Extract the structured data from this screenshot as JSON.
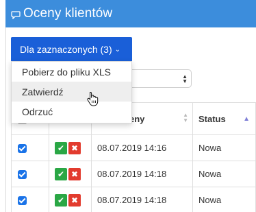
{
  "header": {
    "title": "Oceny klientów",
    "icon": "chat-icon"
  },
  "bulk_actions": {
    "button_label": "Dla zaznaczonych (3)",
    "items": [
      "Pobierz do pliku XLS",
      "Zatwierdź",
      "Odrzuć"
    ]
  },
  "table": {
    "headers": {
      "date": "Data oceny",
      "status": "Status"
    },
    "rows": [
      {
        "date": "08.07.2019 14:16",
        "status": "Nowa",
        "approve": "✔",
        "reject": "✖"
      },
      {
        "date": "08.07.2019 14:18",
        "status": "Nowa",
        "approve": "✔",
        "reject": "✖"
      },
      {
        "date": "08.07.2019 14:18",
        "status": "Nowa",
        "approve": "✔",
        "reject": "✖"
      }
    ]
  },
  "colors": {
    "header": "#3c8ddc",
    "button": "#1a5fd8",
    "approve": "#2aa745",
    "reject": "#e23b2e"
  }
}
